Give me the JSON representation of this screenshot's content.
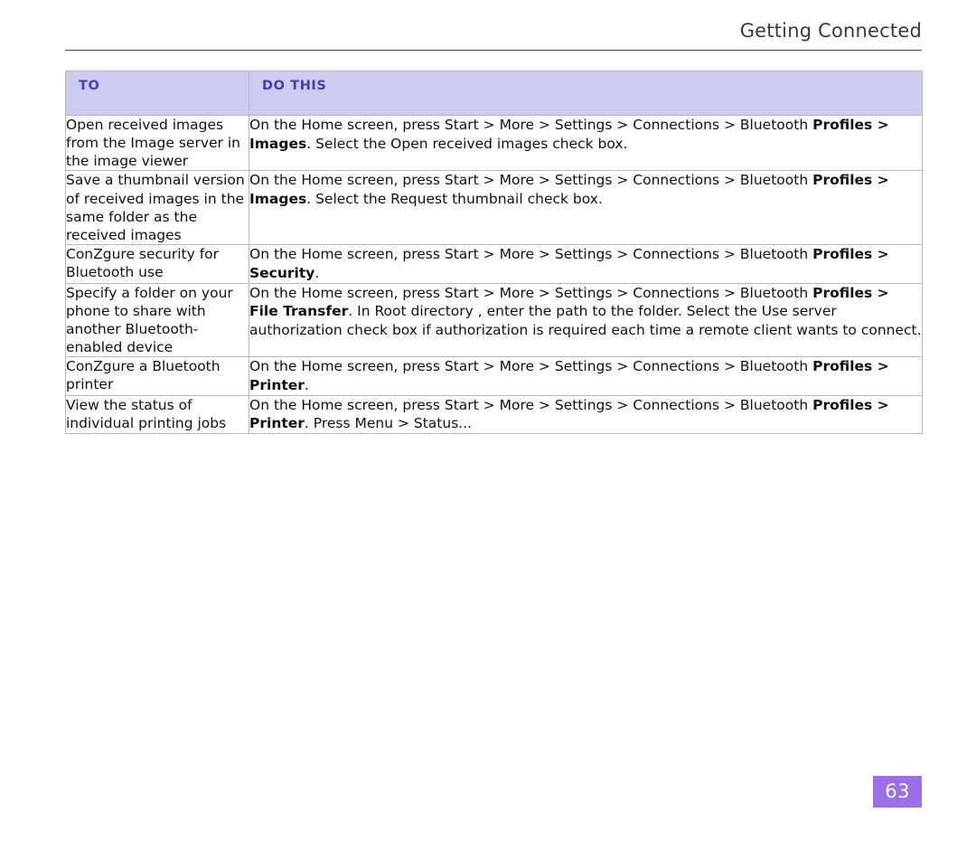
{
  "header": {
    "title": "Getting Connected"
  },
  "table": {
    "columns": [
      "TO",
      "DO THIS"
    ],
    "rows": [
      {
        "to": "Open received images from the Image server in the image viewer",
        "do_parts": [
          {
            "text": "On the Home screen, press Start > More > Settings",
            "bold": false
          },
          {
            "text": " > Connections > Bluetooth ",
            "bold": false
          },
          {
            "text": "Profiles > Images",
            "bold": true
          },
          {
            "text": ". Select the Open received images  check box.",
            "bold": false
          }
        ]
      },
      {
        "to": "Save a thumbnail version of received images in the same folder as the received images",
        "do_parts": [
          {
            "text": "On the Home screen, press Start > More > Settings",
            "bold": false
          },
          {
            "text": " > Connections > Bluetooth ",
            "bold": false
          },
          {
            "text": "Profiles > Images",
            "bold": true
          },
          {
            "text": ". Select the Request thumbnail  check box.",
            "bold": false
          }
        ]
      },
      {
        "to": "ConZgure security for Bluetooth use",
        "do_parts": [
          {
            "text": "On the Home screen, press Start > More > Settings",
            "bold": false
          },
          {
            "text": " > Connections > Bluetooth ",
            "bold": false
          },
          {
            "text": "Profiles > Security",
            "bold": true
          },
          {
            "text": ".",
            "bold": false
          }
        ]
      },
      {
        "to": "Specify a folder on your phone to share with another Bluetooth-enabled device",
        "do_parts": [
          {
            "text": "On the Home screen, press Start > More > Settings",
            "bold": false
          },
          {
            "text": " > Connections > Bluetooth ",
            "bold": false
          },
          {
            "text": "Profiles > File Transfer",
            "bold": true
          },
          {
            "text": ". In Root directory , enter the path to the folder. Select the Use server authorization    check box if authorization is required each time a remote client wants to connect.",
            "bold": false
          }
        ]
      },
      {
        "to": "ConZgure a Bluetooth printer",
        "do_parts": [
          {
            "text": "On the Home screen, press Start > More > Settings",
            "bold": false
          },
          {
            "text": " > Connections > Bluetooth ",
            "bold": false
          },
          {
            "text": "Profiles > Printer",
            "bold": true
          },
          {
            "text": ".",
            "bold": false
          }
        ]
      },
      {
        "to": "View the status of individual printing jobs",
        "do_parts": [
          {
            "text": "On the Home screen, press Start > More > Settings",
            "bold": false
          },
          {
            "text": " > Connections > Bluetooth ",
            "bold": false
          },
          {
            "text": "Profiles > Printer",
            "bold": true
          },
          {
            "text": ". Press Menu > Status...",
            "bold": false
          }
        ]
      }
    ]
  },
  "footer": {
    "page_number": "63"
  },
  "colors": {
    "header_bg": "#ccccf2",
    "header_text": "#4a3bb5",
    "page_badge": "#9a6fe8"
  }
}
